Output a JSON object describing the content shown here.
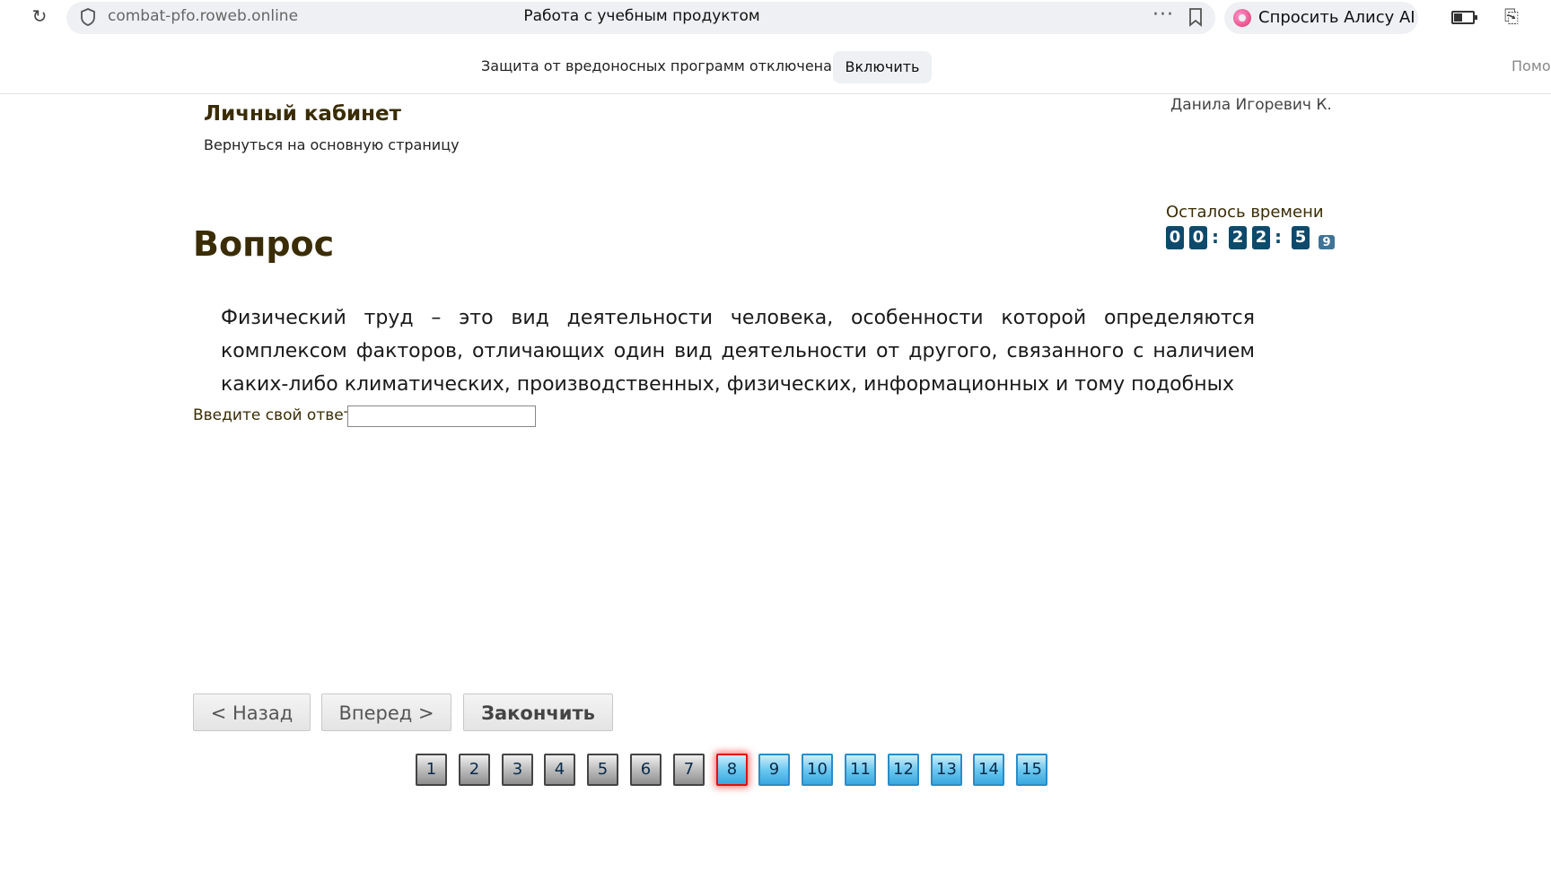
{
  "browser": {
    "url": "combat-pfo.roweb.online",
    "tab_title": "Работа с учебным продуктом",
    "alice_label": "Спросить Алису AI"
  },
  "security_bar": {
    "message": "Защита от вредоносных программ отключена",
    "enable_label": "Включить",
    "help_label": "Помощь"
  },
  "header": {
    "cabinet_title": "Личный кабинет",
    "back_link": "Вернуться на основную страницу",
    "user_name": "Данила Игоревич К."
  },
  "timer": {
    "label": "Осталось времени",
    "digits": [
      "0",
      "0",
      "2",
      "2",
      "5",
      "9"
    ]
  },
  "question": {
    "title": "Вопрос",
    "text": "Физический труд – это вид деятельности человека, особенности которой определяются комплексом факторов, отличающих один вид деятельности от другого, связанного с наличием каких-либо климатических, производственных, физических, информационных и тому подобных",
    "answer_label": "Введите свой ответ",
    "answer_value": ""
  },
  "nav": {
    "back_label": "< Назад",
    "forward_label": "Вперед >",
    "finish_label": "Закончить"
  },
  "pager": {
    "current": 8,
    "pages": [
      "1",
      "2",
      "3",
      "4",
      "5",
      "6",
      "7",
      "8",
      "9",
      "10",
      "11",
      "12",
      "13",
      "14",
      "15"
    ]
  }
}
